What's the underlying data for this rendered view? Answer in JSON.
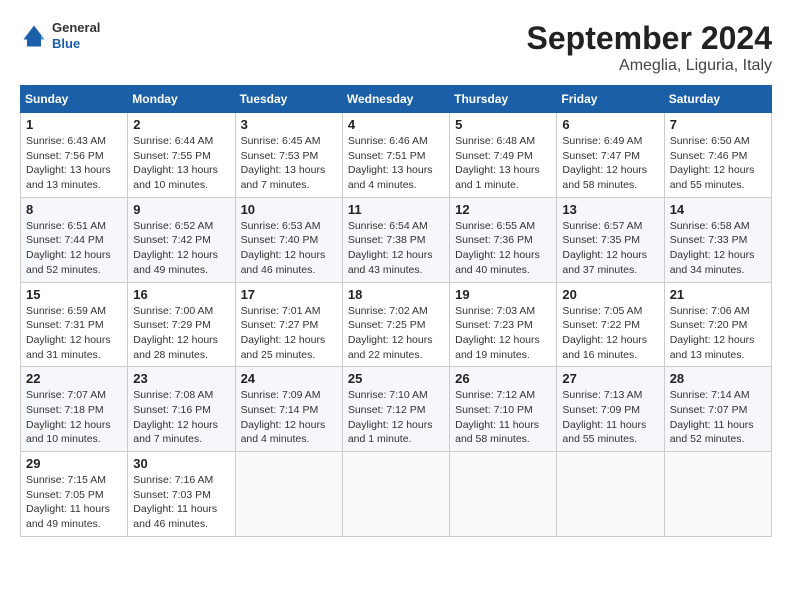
{
  "header": {
    "logo_general": "General",
    "logo_blue": "Blue",
    "month": "September 2024",
    "location": "Ameglia, Liguria, Italy"
  },
  "weekdays": [
    "Sunday",
    "Monday",
    "Tuesday",
    "Wednesday",
    "Thursday",
    "Friday",
    "Saturday"
  ],
  "weeks": [
    [
      {
        "day": "1",
        "sunrise": "Sunrise: 6:43 AM",
        "sunset": "Sunset: 7:56 PM",
        "daylight": "Daylight: 13 hours and 13 minutes."
      },
      {
        "day": "2",
        "sunrise": "Sunrise: 6:44 AM",
        "sunset": "Sunset: 7:55 PM",
        "daylight": "Daylight: 13 hours and 10 minutes."
      },
      {
        "day": "3",
        "sunrise": "Sunrise: 6:45 AM",
        "sunset": "Sunset: 7:53 PM",
        "daylight": "Daylight: 13 hours and 7 minutes."
      },
      {
        "day": "4",
        "sunrise": "Sunrise: 6:46 AM",
        "sunset": "Sunset: 7:51 PM",
        "daylight": "Daylight: 13 hours and 4 minutes."
      },
      {
        "day": "5",
        "sunrise": "Sunrise: 6:48 AM",
        "sunset": "Sunset: 7:49 PM",
        "daylight": "Daylight: 13 hours and 1 minute."
      },
      {
        "day": "6",
        "sunrise": "Sunrise: 6:49 AM",
        "sunset": "Sunset: 7:47 PM",
        "daylight": "Daylight: 12 hours and 58 minutes."
      },
      {
        "day": "7",
        "sunrise": "Sunrise: 6:50 AM",
        "sunset": "Sunset: 7:46 PM",
        "daylight": "Daylight: 12 hours and 55 minutes."
      }
    ],
    [
      {
        "day": "8",
        "sunrise": "Sunrise: 6:51 AM",
        "sunset": "Sunset: 7:44 PM",
        "daylight": "Daylight: 12 hours and 52 minutes."
      },
      {
        "day": "9",
        "sunrise": "Sunrise: 6:52 AM",
        "sunset": "Sunset: 7:42 PM",
        "daylight": "Daylight: 12 hours and 49 minutes."
      },
      {
        "day": "10",
        "sunrise": "Sunrise: 6:53 AM",
        "sunset": "Sunset: 7:40 PM",
        "daylight": "Daylight: 12 hours and 46 minutes."
      },
      {
        "day": "11",
        "sunrise": "Sunrise: 6:54 AM",
        "sunset": "Sunset: 7:38 PM",
        "daylight": "Daylight: 12 hours and 43 minutes."
      },
      {
        "day": "12",
        "sunrise": "Sunrise: 6:55 AM",
        "sunset": "Sunset: 7:36 PM",
        "daylight": "Daylight: 12 hours and 40 minutes."
      },
      {
        "day": "13",
        "sunrise": "Sunrise: 6:57 AM",
        "sunset": "Sunset: 7:35 PM",
        "daylight": "Daylight: 12 hours and 37 minutes."
      },
      {
        "day": "14",
        "sunrise": "Sunrise: 6:58 AM",
        "sunset": "Sunset: 7:33 PM",
        "daylight": "Daylight: 12 hours and 34 minutes."
      }
    ],
    [
      {
        "day": "15",
        "sunrise": "Sunrise: 6:59 AM",
        "sunset": "Sunset: 7:31 PM",
        "daylight": "Daylight: 12 hours and 31 minutes."
      },
      {
        "day": "16",
        "sunrise": "Sunrise: 7:00 AM",
        "sunset": "Sunset: 7:29 PM",
        "daylight": "Daylight: 12 hours and 28 minutes."
      },
      {
        "day": "17",
        "sunrise": "Sunrise: 7:01 AM",
        "sunset": "Sunset: 7:27 PM",
        "daylight": "Daylight: 12 hours and 25 minutes."
      },
      {
        "day": "18",
        "sunrise": "Sunrise: 7:02 AM",
        "sunset": "Sunset: 7:25 PM",
        "daylight": "Daylight: 12 hours and 22 minutes."
      },
      {
        "day": "19",
        "sunrise": "Sunrise: 7:03 AM",
        "sunset": "Sunset: 7:23 PM",
        "daylight": "Daylight: 12 hours and 19 minutes."
      },
      {
        "day": "20",
        "sunrise": "Sunrise: 7:05 AM",
        "sunset": "Sunset: 7:22 PM",
        "daylight": "Daylight: 12 hours and 16 minutes."
      },
      {
        "day": "21",
        "sunrise": "Sunrise: 7:06 AM",
        "sunset": "Sunset: 7:20 PM",
        "daylight": "Daylight: 12 hours and 13 minutes."
      }
    ],
    [
      {
        "day": "22",
        "sunrise": "Sunrise: 7:07 AM",
        "sunset": "Sunset: 7:18 PM",
        "daylight": "Daylight: 12 hours and 10 minutes."
      },
      {
        "day": "23",
        "sunrise": "Sunrise: 7:08 AM",
        "sunset": "Sunset: 7:16 PM",
        "daylight": "Daylight: 12 hours and 7 minutes."
      },
      {
        "day": "24",
        "sunrise": "Sunrise: 7:09 AM",
        "sunset": "Sunset: 7:14 PM",
        "daylight": "Daylight: 12 hours and 4 minutes."
      },
      {
        "day": "25",
        "sunrise": "Sunrise: 7:10 AM",
        "sunset": "Sunset: 7:12 PM",
        "daylight": "Daylight: 12 hours and 1 minute."
      },
      {
        "day": "26",
        "sunrise": "Sunrise: 7:12 AM",
        "sunset": "Sunset: 7:10 PM",
        "daylight": "Daylight: 11 hours and 58 minutes."
      },
      {
        "day": "27",
        "sunrise": "Sunrise: 7:13 AM",
        "sunset": "Sunset: 7:09 PM",
        "daylight": "Daylight: 11 hours and 55 minutes."
      },
      {
        "day": "28",
        "sunrise": "Sunrise: 7:14 AM",
        "sunset": "Sunset: 7:07 PM",
        "daylight": "Daylight: 11 hours and 52 minutes."
      }
    ],
    [
      {
        "day": "29",
        "sunrise": "Sunrise: 7:15 AM",
        "sunset": "Sunset: 7:05 PM",
        "daylight": "Daylight: 11 hours and 49 minutes."
      },
      {
        "day": "30",
        "sunrise": "Sunrise: 7:16 AM",
        "sunset": "Sunset: 7:03 PM",
        "daylight": "Daylight: 11 hours and 46 minutes."
      },
      null,
      null,
      null,
      null,
      null
    ]
  ]
}
